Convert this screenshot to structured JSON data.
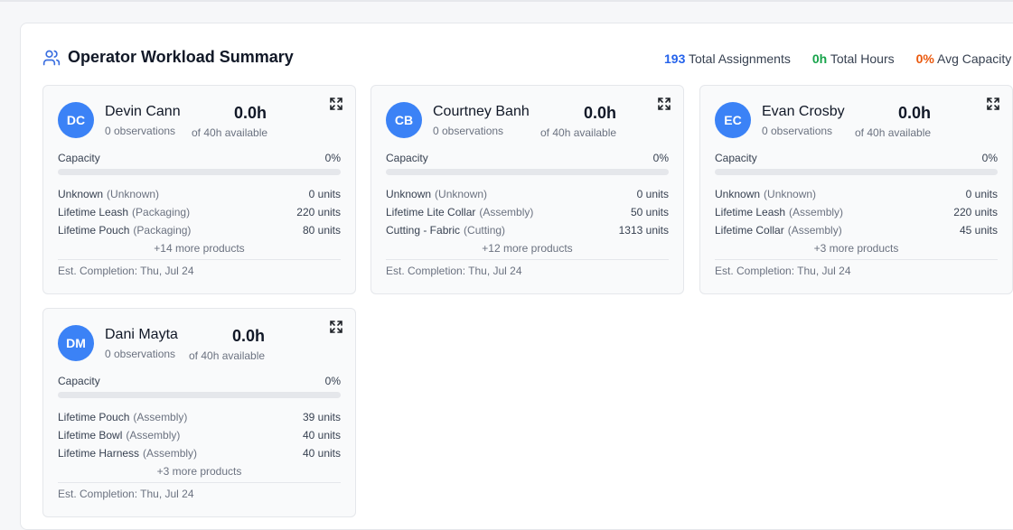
{
  "panel": {
    "title": "Operator Workload Summary",
    "icon": "users-icon",
    "stats": [
      {
        "value": "193",
        "label": "Total Assignments",
        "color": "#2563eb"
      },
      {
        "value": "0h",
        "label": "Total Hours",
        "color": "#16a34a"
      },
      {
        "value": "0%",
        "label": "Avg Capacity",
        "color": "#ea580c"
      }
    ]
  },
  "cards": [
    {
      "initials": "DC",
      "name": "Devin Cann",
      "observations": "0 observations",
      "hours": "0.0h",
      "available": "of 40h available",
      "capacity_label": "Capacity",
      "capacity_pct": "0%",
      "capacity_fraction": 0,
      "products": [
        {
          "name": "Unknown",
          "category": "(Unknown)",
          "units": "0 units"
        },
        {
          "name": "Lifetime Leash",
          "category": "(Packaging)",
          "units": "220 units"
        },
        {
          "name": "Lifetime Pouch",
          "category": "(Packaging)",
          "units": "80 units"
        }
      ],
      "more": "+14 more products",
      "est": "Est. Completion: Thu, Jul 24"
    },
    {
      "initials": "CB",
      "name": "Courtney Banh",
      "observations": "0 observations",
      "hours": "0.0h",
      "available": "of 40h available",
      "capacity_label": "Capacity",
      "capacity_pct": "0%",
      "capacity_fraction": 0,
      "products": [
        {
          "name": "Unknown",
          "category": "(Unknown)",
          "units": "0 units"
        },
        {
          "name": "Lifetime Lite Collar",
          "category": "(Assembly)",
          "units": "50 units"
        },
        {
          "name": "Cutting - Fabric",
          "category": "(Cutting)",
          "units": "1313 units"
        }
      ],
      "more": "+12 more products",
      "est": "Est. Completion: Thu, Jul 24"
    },
    {
      "initials": "EC",
      "name": "Evan Crosby",
      "observations": "0 observations",
      "hours": "0.0h",
      "available": "of 40h available",
      "capacity_label": "Capacity",
      "capacity_pct": "0%",
      "capacity_fraction": 0,
      "products": [
        {
          "name": "Unknown",
          "category": "(Unknown)",
          "units": "0 units"
        },
        {
          "name": "Lifetime Leash",
          "category": "(Assembly)",
          "units": "220 units"
        },
        {
          "name": "Lifetime Collar",
          "category": "(Assembly)",
          "units": "45 units"
        }
      ],
      "more": "+3 more products",
      "est": "Est. Completion: Thu, Jul 24"
    },
    {
      "initials": "DM",
      "name": "Dani Mayta",
      "observations": "0 observations",
      "hours": "0.0h",
      "available": "of 40h available",
      "capacity_label": "Capacity",
      "capacity_pct": "0%",
      "capacity_fraction": 0,
      "products": [
        {
          "name": "Lifetime Pouch",
          "category": "(Assembly)",
          "units": "39 units"
        },
        {
          "name": "Lifetime Bowl",
          "category": "(Assembly)",
          "units": "40 units"
        },
        {
          "name": "Lifetime Harness",
          "category": "(Assembly)",
          "units": "40 units"
        }
      ],
      "more": "+3 more products",
      "est": "Est. Completion: Thu, Jul 24"
    }
  ]
}
